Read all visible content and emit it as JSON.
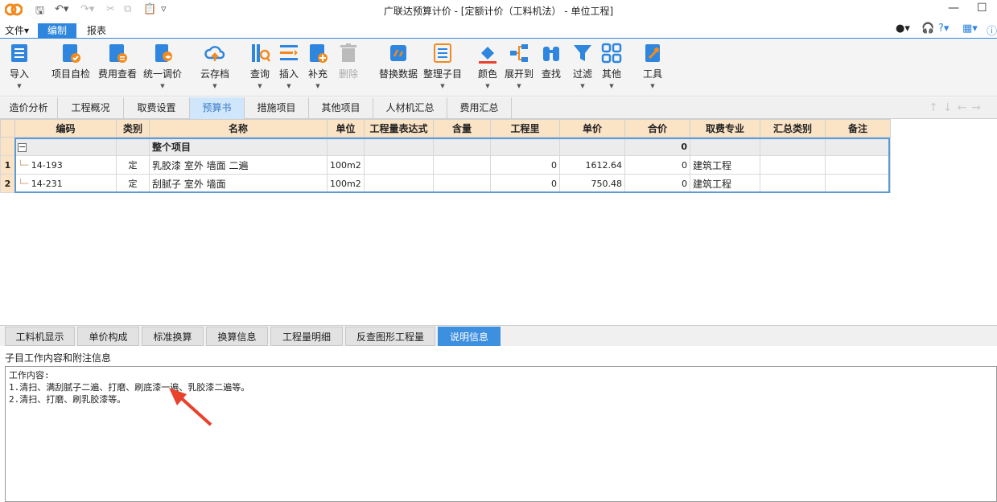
{
  "window": {
    "title": "广联达预算计价 - [定额计价（工料机法） - 单位工程]"
  },
  "menubar": {
    "items": [
      "文件",
      "编制",
      "报表"
    ],
    "active": "编制"
  },
  "ribbon": {
    "buttons": [
      {
        "label": "导入",
        "icon": "import-icon"
      },
      {
        "label": "项目自检",
        "icon": "check-icon"
      },
      {
        "label": "费用查看",
        "icon": "fee-view-icon"
      },
      {
        "label": "统一调价",
        "icon": "price-adjust-icon"
      },
      {
        "label": "云存档",
        "icon": "cloud-upload-icon"
      },
      {
        "label": "查询",
        "icon": "query-icon"
      },
      {
        "label": "插入",
        "icon": "insert-icon"
      },
      {
        "label": "补充",
        "icon": "supplement-icon"
      },
      {
        "label": "删除",
        "icon": "delete-icon"
      },
      {
        "label": "替换数据",
        "icon": "replace-data-icon"
      },
      {
        "label": "整理子目",
        "icon": "organize-icon"
      },
      {
        "label": "颜色",
        "icon": "color-icon"
      },
      {
        "label": "展开到",
        "icon": "expand-icon"
      },
      {
        "label": "查找",
        "icon": "find-icon"
      },
      {
        "label": "过滤",
        "icon": "filter-icon"
      },
      {
        "label": "其他",
        "icon": "other-icon"
      },
      {
        "label": "工具",
        "icon": "tools-icon"
      }
    ]
  },
  "tabs": {
    "items": [
      "造价分析",
      "工程概况",
      "取费设置",
      "预算书",
      "措施项目",
      "其他项目",
      "人材机汇总",
      "费用汇总"
    ],
    "active": "预算书"
  },
  "grid": {
    "headers": [
      "编码",
      "类别",
      "名称",
      "单位",
      "工程量表达式",
      "含量",
      "工程里",
      "单价",
      "合价",
      "取费专业",
      "汇总类别",
      "备注"
    ],
    "main_row": {
      "name": "整个项目",
      "total": "0"
    },
    "rows": [
      {
        "no": "1",
        "code": "14-193",
        "type": "定",
        "name": "乳胶漆 室外 墙面 二遍",
        "unit": "100m2",
        "qty": "0",
        "price": "1612.64",
        "total": "0",
        "major": "建筑工程"
      },
      {
        "no": "2",
        "code": "14-231",
        "type": "定",
        "name": "刮腻子 室外 墙面",
        "unit": "100m2",
        "qty": "0",
        "price": "750.48",
        "total": "0",
        "major": "建筑工程"
      }
    ]
  },
  "bottom_tabs": {
    "items": [
      "工料机显示",
      "单价构成",
      "标准换算",
      "换算信息",
      "工程量明细",
      "反查图形工程量",
      "说明信息"
    ],
    "active": "说明信息"
  },
  "info": {
    "subheading": "子目工作内容和附注信息",
    "lines": [
      "工作内容:",
      "1.清扫、满刮腻子二遍、打磨、刷底漆一遍、乳胶漆二遍等。",
      "2.清扫、打磨、刷乳胶漆等。"
    ]
  },
  "colors": {
    "accent": "#2e86de",
    "header": "#fbe3c6",
    "arrow": "#e8412c"
  }
}
